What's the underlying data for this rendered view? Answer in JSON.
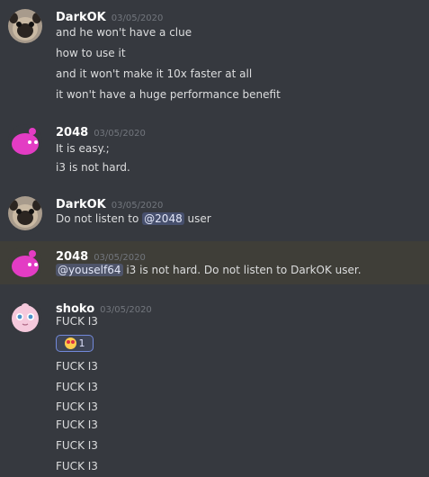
{
  "messages": [
    {
      "author": "DarkOK",
      "timestamp": "03/05/2020",
      "avatar": "pug-avatar",
      "lines": [
        "and he won't have a clue",
        "how to use it",
        "and it won't make it 10x faster at all",
        "it won't have a huge performance benefit"
      ]
    },
    {
      "author": "2048",
      "timestamp": "03/05/2020",
      "avatar": "pink-blob-avatar",
      "lines": [
        "It is easy.;",
        "i3 is not hard."
      ]
    },
    {
      "author": "DarkOK",
      "timestamp": "03/05/2020",
      "avatar": "pug-avatar",
      "line_prefix": "Do not listen to",
      "mention": "@2048",
      "line_suffix": "user"
    },
    {
      "author": "2048",
      "timestamp": "03/05/2020",
      "avatar": "pink-blob-avatar",
      "highlighted": true,
      "mention": "@youself64",
      "line_suffix": "i3 is not hard. Do not listen to DarkOK user."
    },
    {
      "author": "shoko",
      "timestamp": "03/05/2020",
      "avatar": "jigglypuff-avatar",
      "first_line": "FUCK I3",
      "reaction": {
        "emoji": "heart-eyes-emoji",
        "count": "1"
      },
      "more_lines": [
        "FUCK I3",
        "FUCK I3",
        "FUCK I3",
        "FUCK I3",
        "FUCK I3",
        "FUCK I3"
      ]
    }
  ],
  "colors": {
    "background": "#36393f",
    "highlight": "#3f3e38",
    "username": "#ffffff",
    "timestamp": "#72767d",
    "text": "#dcddde",
    "mention_bg": "#4f5a8a",
    "reaction_border": "#7289da"
  }
}
